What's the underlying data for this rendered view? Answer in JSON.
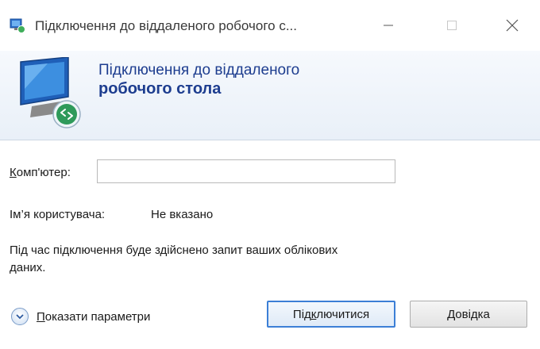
{
  "window": {
    "title": "Підключення до віддаленого робочого с...",
    "icon": "remote-desktop-icon"
  },
  "banner": {
    "line1": "Підключення до віддаленого",
    "line2": "робочого стола"
  },
  "form": {
    "computer_label_underlined": "К",
    "computer_label_rest": "омп'ютер:",
    "computer_value": "",
    "user_label": "Ім’я користувача:",
    "user_value": "Не вказано",
    "info": "Під час підключення буде здійснено запит ваших облікових даних."
  },
  "footer": {
    "options_underlined": "П",
    "options_rest": "оказати параметри",
    "connect_pre": "Під",
    "connect_underlined": "к",
    "connect_post": "лючитися",
    "help_underlined": "Д",
    "help_rest": "овідка"
  },
  "colors": {
    "accent": "#1d3d8f",
    "default_button_border": "#3c7fd6"
  }
}
